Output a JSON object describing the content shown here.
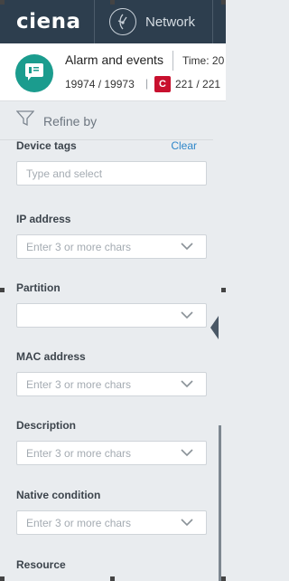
{
  "topbar": {
    "logo": "ciena",
    "nav_label": "Network"
  },
  "header": {
    "title": "Alarm and events",
    "time_label": "Time: 20",
    "counts": "19974 / 19973",
    "critical_badge": "C",
    "critical_count": "221 / 221",
    "icon_color": "#1b9c8e",
    "critical_color": "#c8102e"
  },
  "refine": {
    "label": "Refine by"
  },
  "filters": {
    "device_tags": {
      "label": "Device tags",
      "clear": "Clear",
      "placeholder": "Type and select"
    },
    "ip_address": {
      "label": "IP address",
      "placeholder": "Enter 3 or more chars"
    },
    "partition": {
      "label": "Partition",
      "placeholder": ""
    },
    "mac_address": {
      "label": "MAC address",
      "placeholder": "Enter 3 or more chars"
    },
    "description": {
      "label": "Description",
      "placeholder": "Enter 3 or more chars"
    },
    "native_condition": {
      "label": "Native condition",
      "placeholder": "Enter 3 or more chars"
    },
    "resource": {
      "label": "Resource"
    }
  }
}
